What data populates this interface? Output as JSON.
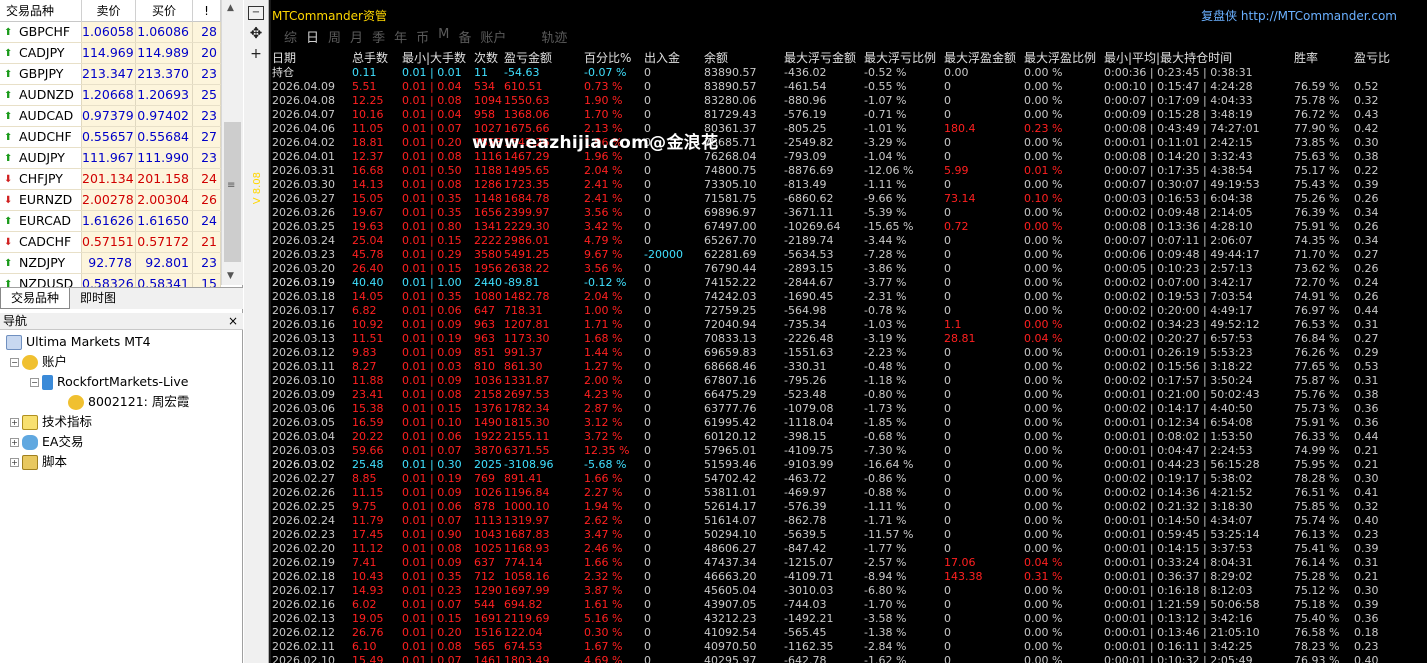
{
  "market_watch": {
    "headers": {
      "symbol": "交易品种",
      "bid": "卖价",
      "ask": "买价",
      "spread": "!"
    },
    "rows": [
      {
        "symbol": "GBPCHF",
        "bid": "1.06058",
        "ask": "1.06086",
        "spread": "28",
        "dir": "up"
      },
      {
        "symbol": "CADJPY",
        "bid": "114.969",
        "ask": "114.989",
        "spread": "20",
        "dir": "up"
      },
      {
        "symbol": "GBPJPY",
        "bid": "213.347",
        "ask": "213.370",
        "spread": "23",
        "dir": "up"
      },
      {
        "symbol": "AUDNZD",
        "bid": "1.20668",
        "ask": "1.20693",
        "spread": "25",
        "dir": "up"
      },
      {
        "symbol": "AUDCAD",
        "bid": "0.97379",
        "ask": "0.97402",
        "spread": "23",
        "dir": "up"
      },
      {
        "symbol": "AUDCHF",
        "bid": "0.55657",
        "ask": "0.55684",
        "spread": "27",
        "dir": "up"
      },
      {
        "symbol": "AUDJPY",
        "bid": "111.967",
        "ask": "111.990",
        "spread": "23",
        "dir": "up"
      },
      {
        "symbol": "CHFJPY",
        "bid": "201.134",
        "ask": "201.158",
        "spread": "24",
        "dir": "dn"
      },
      {
        "symbol": "EURNZD",
        "bid": "2.00278",
        "ask": "2.00304",
        "spread": "26",
        "dir": "dn"
      },
      {
        "symbol": "EURCAD",
        "bid": "1.61626",
        "ask": "1.61650",
        "spread": "24",
        "dir": "up"
      },
      {
        "symbol": "CADCHF",
        "bid": "0.57151",
        "ask": "0.57172",
        "spread": "21",
        "dir": "dn"
      },
      {
        "symbol": "NZDJPY",
        "bid": "92.778",
        "ask": "92.801",
        "spread": "23",
        "dir": "up"
      },
      {
        "symbol": "NZDUSD",
        "bid": "0.58326",
        "ask": "0.58341",
        "spread": "15",
        "dir": "up"
      }
    ],
    "tabs": [
      "交易品种",
      "即时图"
    ]
  },
  "navigator": {
    "title": "导航",
    "close": "×",
    "items": [
      {
        "label": "Ultima Markets MT4"
      },
      {
        "label": "账户"
      },
      {
        "label": "RockfortMarkets-Live"
      },
      {
        "label": "8002121: 周宏霞"
      },
      {
        "label": "技术指标"
      },
      {
        "label": "EA交易"
      },
      {
        "label": "脚本"
      }
    ]
  },
  "ea": {
    "title": "MTCommander资管",
    "brand_name": "复盘侠",
    "brand_url": "http://MTCommander.com",
    "tabs": [
      "综",
      "日",
      "周",
      "月",
      "季",
      "年",
      "币",
      "M",
      "备",
      "账户",
      "轨迹"
    ],
    "active_tab": "日",
    "watermark": "www.eazhijia.com@金浪花",
    "side_label": "V 8.08",
    "headers": [
      "日期",
      "总手数",
      "最小|大手数",
      "次数",
      "盈亏金额",
      "百分比%",
      "出入金",
      "余额",
      "最大浮亏金额",
      "最大浮亏比例",
      "最大浮盈金额",
      "最大浮盈比例",
      "最小|平均|最大持仓时间",
      "胜率",
      "盈亏比"
    ],
    "colors": {
      "header": "#e0e0e0",
      "pos": "#ff2020",
      "neg": "#c8c8c8",
      "cyan": "#40e0ff",
      "neutral": "#c8c8c8"
    }
  },
  "table_rows": [
    {
      "c": [
        "持仓",
        "0.11",
        "0.01 | 0.01",
        "11",
        "-54.63",
        "-0.07 %",
        "0",
        "83890.57",
        "-436.02",
        "-0.52 %",
        "0.00",
        "0.00 %",
        "0:00:36 | 0:23:45 | 0:38:31",
        "",
        ""
      ],
      "t": "hold"
    },
    {
      "c": [
        "2026.04.09",
        "5.51",
        "0.01 | 0.04",
        "534",
        "610.51",
        "0.73 %",
        "0",
        "83890.57",
        "-461.54",
        "-0.55 %",
        "0",
        "0.00 %",
        "0:00:10 | 0:15:47 | 4:24:28",
        "76.59 %",
        "0.52"
      ],
      "t": "p"
    },
    {
      "c": [
        "2026.04.08",
        "12.25",
        "0.01 | 0.08",
        "1094",
        "1550.63",
        "1.90 %",
        "0",
        "83280.06",
        "-880.96",
        "-1.07 %",
        "0",
        "0.00 %",
        "0:00:07 | 0:17:09 | 4:04:33",
        "75.78 %",
        "0.32"
      ],
      "t": "p"
    },
    {
      "c": [
        "2026.04.07",
        "10.16",
        "0.01 | 0.04",
        "958",
        "1368.06",
        "1.70 %",
        "0",
        "81729.43",
        "-576.19",
        "-0.71 %",
        "0",
        "0.00 %",
        "0:00:09 | 0:15:28 | 3:48:19",
        "76.72 %",
        "0.43"
      ],
      "t": "p"
    },
    {
      "c": [
        "2026.04.06",
        "11.05",
        "0.01 | 0.07",
        "1027",
        "1675.66",
        "2.13 %",
        "0",
        "80361.37",
        "-805.25",
        "-1.01 %",
        "180.4",
        "0.23 %",
        "0:00:08 | 0:43:49 | 74:27:01",
        "77.90 %",
        "0.42"
      ],
      "t": "p",
      "fp": true
    },
    {
      "c": [
        "2026.04.02",
        "18.81",
        "0.01 | 0.20",
        "1553",
        "1542.26",
        "1.96 %",
        "0",
        "78685.71",
        "-2549.82",
        "-3.29 %",
        "0",
        "0.00 %",
        "0:00:01 | 0:11:01 | 2:42:15",
        "73.85 %",
        "0.30"
      ],
      "t": "p"
    },
    {
      "c": [
        "2026.04.01",
        "12.37",
        "0.01 | 0.08",
        "1116",
        "1467.29",
        "1.96 %",
        "0",
        "76268.04",
        "-793.09",
        "-1.04 %",
        "0",
        "0.00 %",
        "0:00:08 | 0:14:20 | 3:32:43",
        "75.63 %",
        "0.38"
      ],
      "t": "p"
    },
    {
      "c": [
        "2026.03.31",
        "16.68",
        "0.01 | 0.50",
        "1188",
        "1495.65",
        "2.04 %",
        "0",
        "74800.75",
        "-8876.69",
        "-12.06 %",
        "5.99",
        "0.01 %",
        "0:00:07 | 0:17:35 | 4:38:54",
        "75.17 %",
        "0.22"
      ],
      "t": "p",
      "fp": true
    },
    {
      "c": [
        "2026.03.30",
        "14.13",
        "0.01 | 0.08",
        "1286",
        "1723.35",
        "2.41 %",
        "0",
        "73305.10",
        "-813.49",
        "-1.11 %",
        "0",
        "0.00 %",
        "0:00:07 | 0:30:07 | 49:19:53",
        "75.43 %",
        "0.39"
      ],
      "t": "p"
    },
    {
      "c": [
        "2026.03.27",
        "15.05",
        "0.01 | 0.35",
        "1148",
        "1684.78",
        "2.41 %",
        "0",
        "71581.75",
        "-6860.62",
        "-9.66 %",
        "73.14",
        "0.10 %",
        "0:00:03 | 0:16:53 | 6:04:38",
        "75.26 %",
        "0.26"
      ],
      "t": "p",
      "fp": true
    },
    {
      "c": [
        "2026.03.26",
        "19.67",
        "0.01 | 0.35",
        "1656",
        "2399.97",
        "3.56 %",
        "0",
        "69896.97",
        "-3671.11",
        "-5.39 %",
        "0",
        "0.00 %",
        "0:00:02 | 0:09:48 | 2:14:05",
        "76.39 %",
        "0.34"
      ],
      "t": "p"
    },
    {
      "c": [
        "2026.03.25",
        "19.63",
        "0.01 | 0.80",
        "1341",
        "2229.30",
        "3.42 %",
        "0",
        "67497.00",
        "-10269.64",
        "-15.65 %",
        "0.72",
        "0.00 %",
        "0:00:08 | 0:13:36 | 4:28:10",
        "75.91 %",
        "0.26"
      ],
      "t": "p",
      "fp": true
    },
    {
      "c": [
        "2026.03.24",
        "25.04",
        "0.01 | 0.15",
        "2222",
        "2986.01",
        "4.79 %",
        "0",
        "65267.70",
        "-2189.74",
        "-3.44 %",
        "0",
        "0.00 %",
        "0:00:07 | 0:07:11 | 2:06:07",
        "74.35 %",
        "0.34"
      ],
      "t": "p"
    },
    {
      "c": [
        "2026.03.23",
        "45.78",
        "0.01 | 0.29",
        "3580",
        "5491.25",
        "9.67 %",
        "-20000",
        "62281.69",
        "-5634.53",
        "-7.28 %",
        "0",
        "0.00 %",
        "0:00:06 | 0:09:48 | 49:44:17",
        "71.70 %",
        "0.27"
      ],
      "t": "p",
      "cyan_flow": true
    },
    {
      "c": [
        "2026.03.20",
        "26.40",
        "0.01 | 0.15",
        "1956",
        "2638.22",
        "3.56 %",
        "0",
        "76790.44",
        "-2893.15",
        "-3.86 %",
        "0",
        "0.00 %",
        "0:00:05 | 0:10:23 | 2:57:13",
        "73.62 %",
        "0.26"
      ],
      "t": "p"
    },
    {
      "c": [
        "2026.03.19",
        "40.40",
        "0.01 | 1.00",
        "2440",
        "-89.81",
        "-0.12 %",
        "0",
        "74152.22",
        "-2844.67",
        "-3.77 %",
        "0",
        "0.00 %",
        "0:00:02 | 0:07:00 | 3:42:17",
        "72.70 %",
        "0.24"
      ],
      "t": "n"
    },
    {
      "c": [
        "2026.03.18",
        "14.05",
        "0.01 | 0.35",
        "1080",
        "1482.78",
        "2.04 %",
        "0",
        "74242.03",
        "-1690.45",
        "-2.31 %",
        "0",
        "0.00 %",
        "0:00:02 | 0:19:53 | 7:03:54",
        "74.91 %",
        "0.26"
      ],
      "t": "p"
    },
    {
      "c": [
        "2026.03.17",
        "6.82",
        "0.01 | 0.06",
        "647",
        "718.31",
        "1.00 %",
        "0",
        "72759.25",
        "-564.98",
        "-0.78 %",
        "0",
        "0.00 %",
        "0:00:02 | 0:20:00 | 4:49:17",
        "76.97 %",
        "0.44"
      ],
      "t": "p"
    },
    {
      "c": [
        "2026.03.16",
        "10.92",
        "0.01 | 0.09",
        "963",
        "1207.81",
        "1.71 %",
        "0",
        "72040.94",
        "-735.34",
        "-1.03 %",
        "1.1",
        "0.00 %",
        "0:00:02 | 0:34:23 | 49:52:12",
        "76.53 %",
        "0.31"
      ],
      "t": "p",
      "fp": true
    },
    {
      "c": [
        "2026.03.13",
        "11.51",
        "0.01 | 0.19",
        "963",
        "1173.30",
        "1.68 %",
        "0",
        "70833.13",
        "-2226.48",
        "-3.19 %",
        "28.81",
        "0.04 %",
        "0:00:02 | 0:20:27 | 6:57:53",
        "76.84 %",
        "0.27"
      ],
      "t": "p",
      "fp": true
    },
    {
      "c": [
        "2026.03.12",
        "9.83",
        "0.01 | 0.09",
        "851",
        "991.37",
        "1.44 %",
        "0",
        "69659.83",
        "-1551.63",
        "-2.23 %",
        "0",
        "0.00 %",
        "0:00:01 | 0:26:19 | 5:53:23",
        "76.26 %",
        "0.29"
      ],
      "t": "p"
    },
    {
      "c": [
        "2026.03.11",
        "8.27",
        "0.01 | 0.03",
        "810",
        "861.30",
        "1.27 %",
        "0",
        "68668.46",
        "-330.31",
        "-0.48 %",
        "0",
        "0.00 %",
        "0:00:02 | 0:15:56 | 3:18:22",
        "77.65 %",
        "0.53"
      ],
      "t": "p"
    },
    {
      "c": [
        "2026.03.10",
        "11.88",
        "0.01 | 0.09",
        "1036",
        "1331.87",
        "2.00 %",
        "0",
        "67807.16",
        "-795.26",
        "-1.18 %",
        "0",
        "0.00 %",
        "0:00:02 | 0:17:57 | 3:50:24",
        "75.87 %",
        "0.31"
      ],
      "t": "p"
    },
    {
      "c": [
        "2026.03.09",
        "23.41",
        "0.01 | 0.08",
        "2158",
        "2697.53",
        "4.23 %",
        "0",
        "66475.29",
        "-523.48",
        "-0.80 %",
        "0",
        "0.00 %",
        "0:00:01 | 0:21:00 | 50:02:43",
        "75.76 %",
        "0.38"
      ],
      "t": "p"
    },
    {
      "c": [
        "2026.03.06",
        "15.38",
        "0.01 | 0.15",
        "1376",
        "1782.34",
        "2.87 %",
        "0",
        "63777.76",
        "-1079.08",
        "-1.73 %",
        "0",
        "0.00 %",
        "0:00:02 | 0:14:17 | 4:40:50",
        "75.73 %",
        "0.36"
      ],
      "t": "p"
    },
    {
      "c": [
        "2026.03.05",
        "16.59",
        "0.01 | 0.10",
        "1490",
        "1815.30",
        "3.12 %",
        "0",
        "61995.42",
        "-1118.04",
        "-1.85 %",
        "0",
        "0.00 %",
        "0:00:01 | 0:12:34 | 6:54:08",
        "75.91 %",
        "0.36"
      ],
      "t": "p"
    },
    {
      "c": [
        "2026.03.04",
        "20.22",
        "0.01 | 0.06",
        "1922",
        "2155.11",
        "3.72 %",
        "0",
        "60120.12",
        "-398.15",
        "-0.68 %",
        "0",
        "0.00 %",
        "0:00:01 | 0:08:02 | 1:53:50",
        "76.33 %",
        "0.44"
      ],
      "t": "p"
    },
    {
      "c": [
        "2026.03.03",
        "59.66",
        "0.01 | 0.07",
        "3870",
        "6371.55",
        "12.35 %",
        "0",
        "57965.01",
        "-4109.75",
        "-7.30 %",
        "0",
        "0.00 %",
        "0:00:01 | 0:04:47 | 2:24:53",
        "74.99 %",
        "0.21"
      ],
      "t": "p"
    },
    {
      "c": [
        "2026.03.02",
        "25.48",
        "0.01 | 0.30",
        "2025",
        "-3108.96",
        "-5.68 %",
        "0",
        "51593.46",
        "-9103.99",
        "-16.64 %",
        "0",
        "0.00 %",
        "0:00:01 | 0:44:23 | 56:15:28",
        "75.95 %",
        "0.21"
      ],
      "t": "n"
    },
    {
      "c": [
        "2026.02.27",
        "8.85",
        "0.01 | 0.19",
        "769",
        "891.41",
        "1.66 %",
        "0",
        "54702.42",
        "-463.72",
        "-0.86 %",
        "0",
        "0.00 %",
        "0:00:02 | 0:19:17 | 5:38:02",
        "78.28 %",
        "0.30"
      ],
      "t": "p"
    },
    {
      "c": [
        "2026.02.26",
        "11.15",
        "0.01 | 0.09",
        "1026",
        "1196.84",
        "2.27 %",
        "0",
        "53811.01",
        "-469.97",
        "-0.88 %",
        "0",
        "0.00 %",
        "0:00:02 | 0:14:36 | 4:21:52",
        "76.51 %",
        "0.41"
      ],
      "t": "p"
    },
    {
      "c": [
        "2026.02.25",
        "9.75",
        "0.01 | 0.06",
        "878",
        "1000.10",
        "1.94 %",
        "0",
        "52614.17",
        "-576.39",
        "-1.11 %",
        "0",
        "0.00 %",
        "0:00:02 | 0:21:32 | 3:18:30",
        "75.85 %",
        "0.32"
      ],
      "t": "p"
    },
    {
      "c": [
        "2026.02.24",
        "11.79",
        "0.01 | 0.07",
        "1113",
        "1319.97",
        "2.62 %",
        "0",
        "51614.07",
        "-862.78",
        "-1.71 %",
        "0",
        "0.00 %",
        "0:00:01 | 0:14:50 | 4:34:07",
        "75.74 %",
        "0.40"
      ],
      "t": "p"
    },
    {
      "c": [
        "2026.02.23",
        "17.45",
        "0.01 | 0.90",
        "1043",
        "1687.83",
        "3.47 %",
        "0",
        "50294.10",
        "-5639.5",
        "-11.57 %",
        "0",
        "0.00 %",
        "0:00:01 | 0:59:45 | 53:25:14",
        "76.13 %",
        "0.23"
      ],
      "t": "p"
    },
    {
      "c": [
        "2026.02.20",
        "11.12",
        "0.01 | 0.08",
        "1025",
        "1168.93",
        "2.46 %",
        "0",
        "48606.27",
        "-847.42",
        "-1.77 %",
        "0",
        "0.00 %",
        "0:00:01 | 0:14:15 | 3:37:53",
        "75.41 %",
        "0.39"
      ],
      "t": "p"
    },
    {
      "c": [
        "2026.02.19",
        "7.41",
        "0.01 | 0.09",
        "637",
        "774.14",
        "1.66 %",
        "0",
        "47437.34",
        "-1215.07",
        "-2.57 %",
        "17.06",
        "0.04 %",
        "0:00:01 | 0:33:24 | 8:04:31",
        "76.14 %",
        "0.31"
      ],
      "t": "p",
      "fp": true
    },
    {
      "c": [
        "2026.02.18",
        "10.43",
        "0.01 | 0.35",
        "712",
        "1058.16",
        "2.32 %",
        "0",
        "46663.20",
        "-4109.71",
        "-8.94 %",
        "143.38",
        "0.31 %",
        "0:00:01 | 0:36:37 | 8:29:02",
        "75.28 %",
        "0.21"
      ],
      "t": "p",
      "fp": true
    },
    {
      "c": [
        "2026.02.17",
        "14.93",
        "0.01 | 0.23",
        "1290",
        "1697.99",
        "3.87 %",
        "0",
        "45605.04",
        "-3010.03",
        "-6.80 %",
        "0",
        "0.00 %",
        "0:00:01 | 0:16:18 | 8:12:03",
        "75.12 %",
        "0.30"
      ],
      "t": "p"
    },
    {
      "c": [
        "2026.02.16",
        "6.02",
        "0.01 | 0.07",
        "544",
        "694.82",
        "1.61 %",
        "0",
        "43907.05",
        "-744.03",
        "-1.70 %",
        "0",
        "0.00 %",
        "0:00:01 | 1:21:59 | 50:06:58",
        "75.18 %",
        "0.39"
      ],
      "t": "p"
    },
    {
      "c": [
        "2026.02.13",
        "19.05",
        "0.01 | 0.15",
        "1691",
        "2119.69",
        "5.16 %",
        "0",
        "43212.23",
        "-1492.21",
        "-3.58 %",
        "0",
        "0.00 %",
        "0:00:01 | 0:13:12 | 3:42:16",
        "75.40 %",
        "0.36"
      ],
      "t": "p"
    },
    {
      "c": [
        "2026.02.12",
        "26.76",
        "0.01 | 0.20",
        "1516",
        "122.04",
        "0.30 %",
        "0",
        "41092.54",
        "-565.45",
        "-1.38 %",
        "0",
        "0.00 %",
        "0:00:01 | 0:13:46 | 21:05:10",
        "76.58 %",
        "0.18"
      ],
      "t": "p"
    },
    {
      "c": [
        "2026.02.11",
        "6.10",
        "0.01 | 0.08",
        "565",
        "674.53",
        "1.67 %",
        "0",
        "40970.50",
        "-1162.35",
        "-2.84 %",
        "0",
        "0.00 %",
        "0:00:01 | 0:16:11 | 3:42:25",
        "78.23 %",
        "0.23"
      ],
      "t": "p"
    },
    {
      "c": [
        "2026.02.10",
        "15.49",
        "0.01 | 0.07",
        "1461",
        "1803.49",
        "4.69 %",
        "0",
        "40295.97",
        "-642.78",
        "-1.62 %",
        "0",
        "0.00 %",
        "0:00:01 | 0:10:32 | 2:05:49",
        "76.93 %",
        "0.40"
      ],
      "t": "p"
    }
  ]
}
